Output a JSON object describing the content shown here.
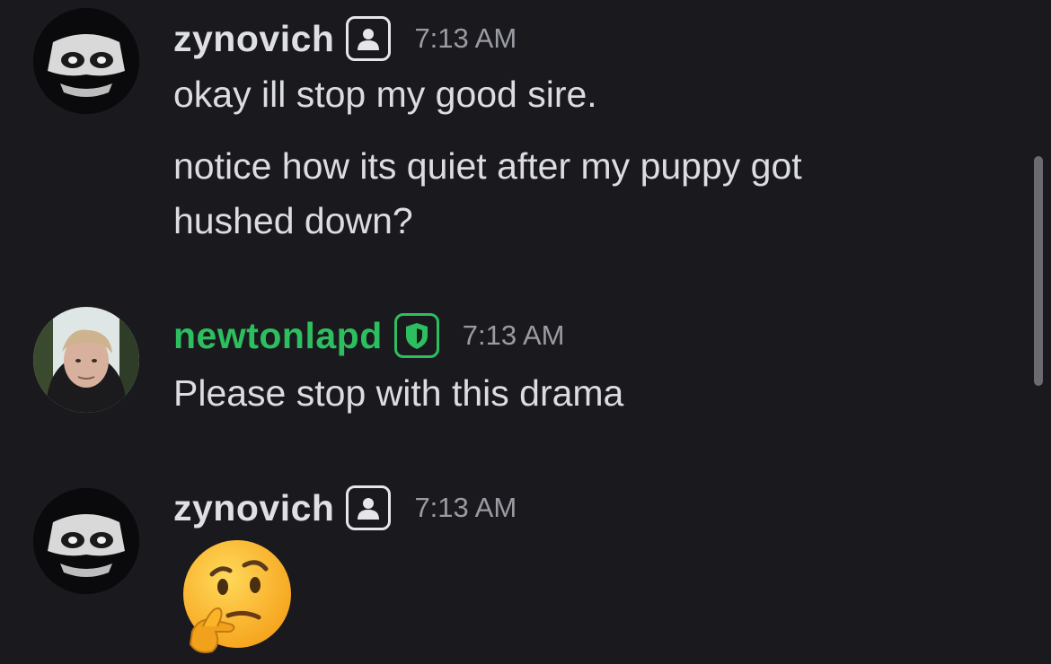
{
  "messages": [
    {
      "author": "zynovich",
      "badge_icon": "user-icon",
      "time": "7:13 AM",
      "lines": [
        "okay ill stop my good sire.",
        "notice how its quiet after my puppy got",
        "hushed down?"
      ]
    },
    {
      "author": "newtonlapd",
      "badge_icon": "shield-icon",
      "author_color": "#2dbf5f",
      "time": "7:13 AM",
      "lines": [
        "Please stop with this drama"
      ]
    },
    {
      "author": "zynovich",
      "badge_icon": "user-icon",
      "time": "7:13 AM",
      "emoji": "🤔",
      "emoji_icon": "thinking-face-icon"
    }
  ]
}
